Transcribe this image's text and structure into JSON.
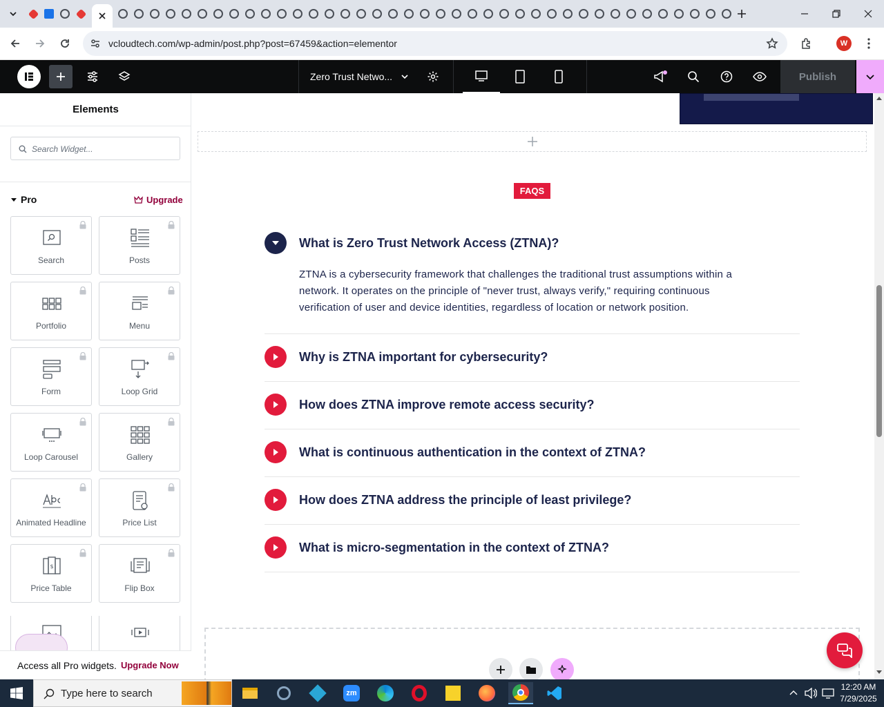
{
  "browser": {
    "url": "vcloudtech.com/wp-admin/post.php?post=67459&action=elementor",
    "profile_initial": "W"
  },
  "editor": {
    "page_title": "Zero Trust Netwo...",
    "publish_label": "Publish"
  },
  "sidebar": {
    "title": "Elements",
    "search_placeholder": "Search Widget...",
    "category": "Pro",
    "upgrade_label": "Upgrade",
    "widgets": [
      {
        "label": "Search",
        "icon": "search-widget-icon"
      },
      {
        "label": "Posts",
        "icon": "posts-widget-icon"
      },
      {
        "label": "Portfolio",
        "icon": "portfolio-widget-icon"
      },
      {
        "label": "Menu",
        "icon": "menu-widget-icon"
      },
      {
        "label": "Form",
        "icon": "form-widget-icon"
      },
      {
        "label": "Loop Grid",
        "icon": "loop-grid-widget-icon"
      },
      {
        "label": "Loop Carousel",
        "icon": "loop-carousel-widget-icon"
      },
      {
        "label": "Gallery",
        "icon": "gallery-widget-icon"
      },
      {
        "label": "Animated Headline",
        "icon": "animated-headline-widget-icon"
      },
      {
        "label": "Price List",
        "icon": "price-list-widget-icon"
      },
      {
        "label": "Price Table",
        "icon": "price-table-widget-icon"
      },
      {
        "label": "Flip Box",
        "icon": "flip-box-widget-icon"
      }
    ],
    "promo_text": "Access all Pro widgets.",
    "promo_link": "Upgrade Now"
  },
  "canvas": {
    "faq_badge": "FAQS",
    "faqs": [
      {
        "question": "What is Zero Trust Network Access (ZTNA)?",
        "expanded": true,
        "answer_lines": [
          "ZTNA is a cybersecurity framework that challenges the traditional trust assumptions within a",
          "network. It operates on the principle of \"never trust, always verify,\" requiring continuous",
          "verification of user and device identities, regardless of location or network position."
        ]
      },
      {
        "question": "Why is ZTNA important for cybersecurity?",
        "expanded": false
      },
      {
        "question": "How does ZTNA improve remote access security?",
        "expanded": false
      },
      {
        "question": "What is continuous authentication in the context of ZTNA?",
        "expanded": false
      },
      {
        "question": "How does ZTNA address the principle of least privilege?",
        "expanded": false
      },
      {
        "question": "What is micro-segmentation in the context of ZTNA?",
        "expanded": false
      }
    ]
  },
  "taskbar": {
    "search_placeholder": "Type here to search",
    "time": "12:20 AM",
    "date": "7/29/2025"
  },
  "colors": {
    "accent_red": "#e21b3c",
    "navy": "#1c244b",
    "elementor_pink": "#92003b",
    "editor_bar": "#0c0d0e"
  }
}
